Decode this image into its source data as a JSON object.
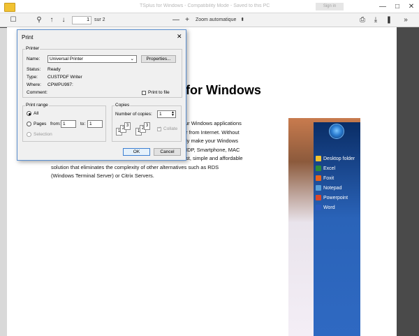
{
  "titlebar": {
    "title": "TSplus for Windows - Compatibility Mode - Saved to this PC",
    "button": "Sign in",
    "minimize": "—",
    "maximize": "□",
    "close": "✕"
  },
  "toolbar": {
    "sidebar_icon": "☐",
    "search_icon": "⚲",
    "prev_icon": "↑",
    "next_icon": "↓",
    "page_value": "1",
    "page_of": "sur 2",
    "zoom_out": "—",
    "zoom_in": "+",
    "zoom_value": "Zoom automatique",
    "zoom_caret": "⬍",
    "print_icon": "⎙",
    "download_icon": "⤓",
    "bookmark_icon": "❚",
    "more_icon": "»"
  },
  "document": {
    "heading": "for Windows",
    "lines": [
      "ur Windows applications",
      "r from Internet. Without",
      "ly make your Windows",
      "IDP, Smartphone, MAC",
      "st, simple and affordable",
      "solution that eliminates the complexity of other alternatives such as RDS",
      "(Windows Terminal Server) or Citrix Servers."
    ]
  },
  "screenshot_menu": {
    "items": [
      "Desktop folder",
      "Excel",
      "Foxit",
      "Notepad",
      "Powerpoint",
      "Word"
    ],
    "colors": [
      "#f2c230",
      "#2e8b3a",
      "#e8641c",
      "#5aa0d8",
      "#d9482b",
      "#2b5bbf"
    ]
  },
  "print_dialog": {
    "title": "Print",
    "close": "✕",
    "printer_group": "Printer",
    "name_label": "Name:",
    "name_value": "Universal Printer",
    "properties": "Properties...",
    "status_label": "Status:",
    "status_value": "Ready",
    "type_label": "Type:",
    "type_value": "CUSTPDF Writer",
    "where_label": "Where:",
    "where_value": "CPWPU997:",
    "comment_label": "Comment:",
    "print_to_file": "Print to file",
    "range_group": "Print range",
    "all": "All",
    "pages": "Pages",
    "from_label": "from:",
    "from_value": "1",
    "to_label": "to:",
    "to_value": "1",
    "selection": "Selection",
    "copies_group": "Copies",
    "copies_label": "Number of copies:",
    "copies_value": "1",
    "collate": "Collate",
    "ok": "OK",
    "cancel": "Cancel"
  }
}
